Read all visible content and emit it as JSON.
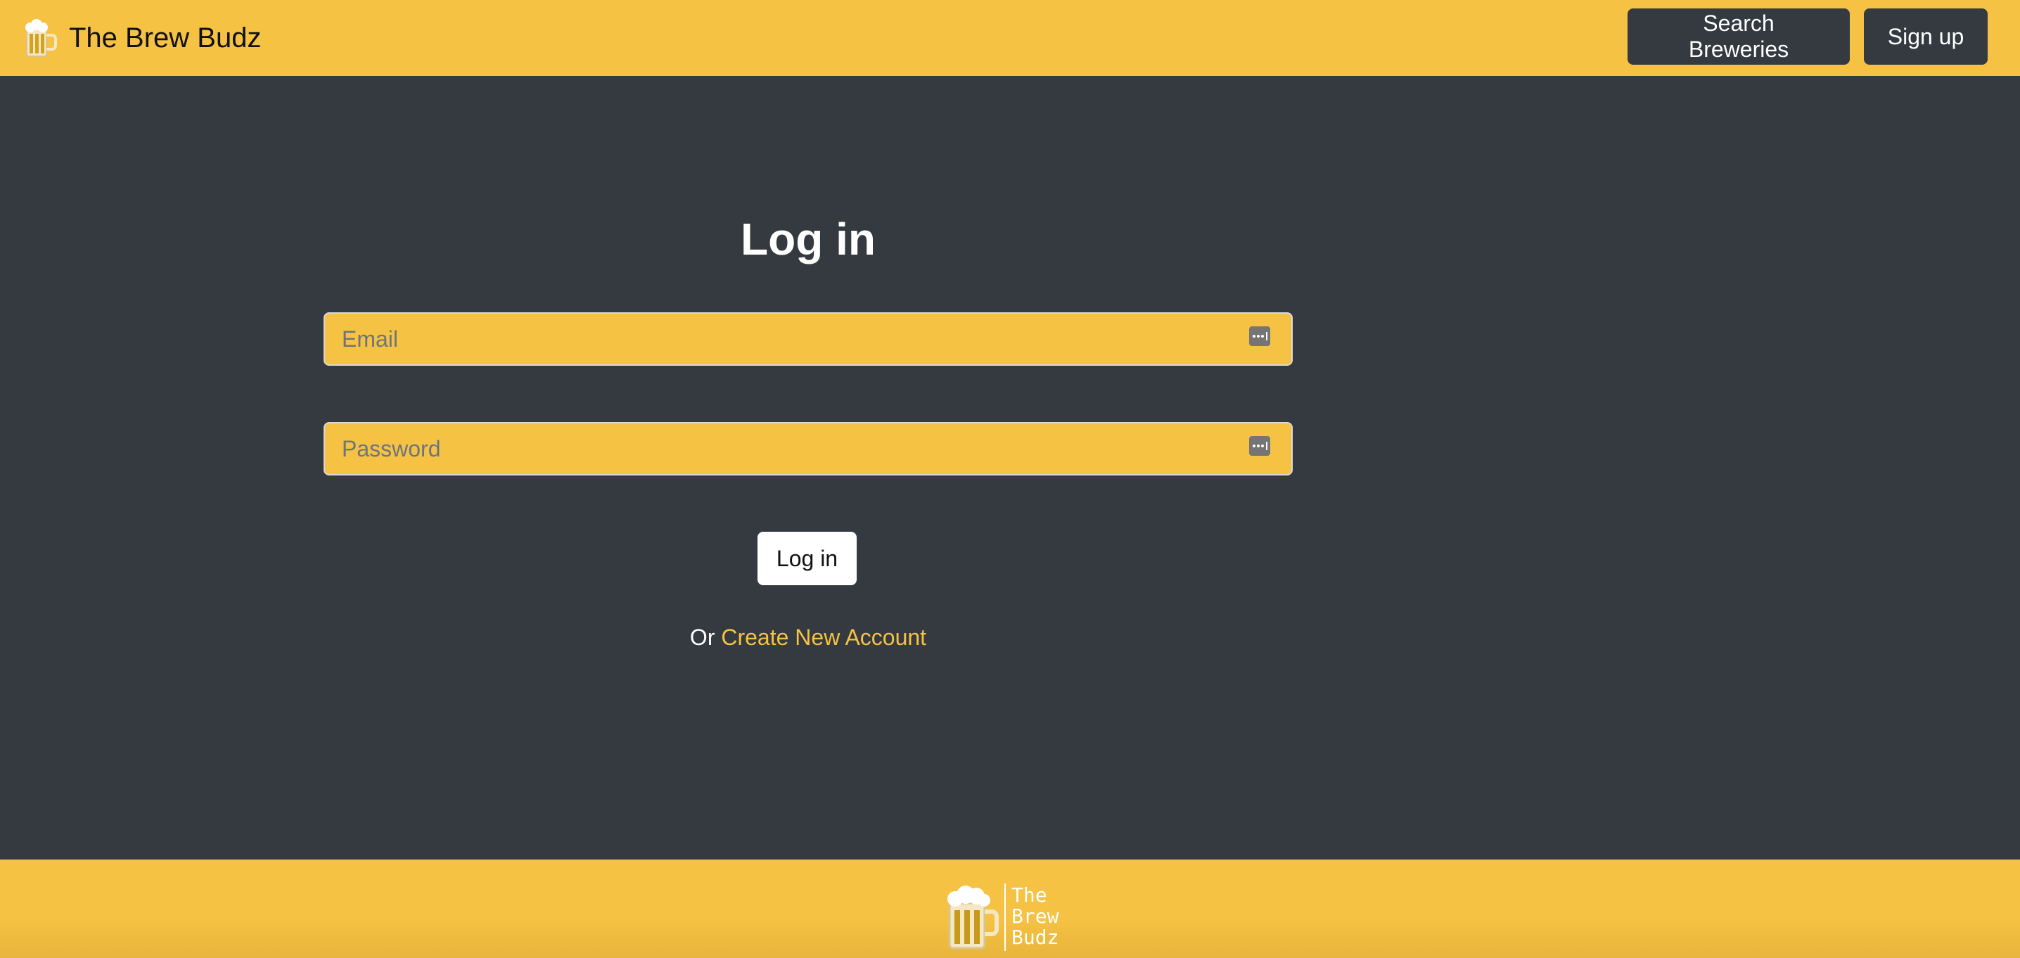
{
  "header": {
    "brand_name": "The Brew Budz",
    "brand_icon": "beer-mug-icon",
    "nav_buttons": [
      {
        "label": "Search Breweries"
      },
      {
        "label": "Sign up"
      }
    ]
  },
  "login_form": {
    "title": "Log in",
    "email_placeholder": "Email",
    "email_value": "",
    "password_placeholder": "Password",
    "password_value": "",
    "field_icon": "password-manager-key-icon",
    "submit_label": "Log in",
    "alt_prefix": "Or ",
    "create_account_link": "Create New Account"
  },
  "footer": {
    "logo_icon": "beer-mug-icon",
    "logo_lines": [
      "The",
      "Brew",
      "Budz"
    ]
  },
  "colors": {
    "accent_yellow": "#f6c243",
    "dark_background": "#343a40",
    "white": "#ffffff"
  }
}
